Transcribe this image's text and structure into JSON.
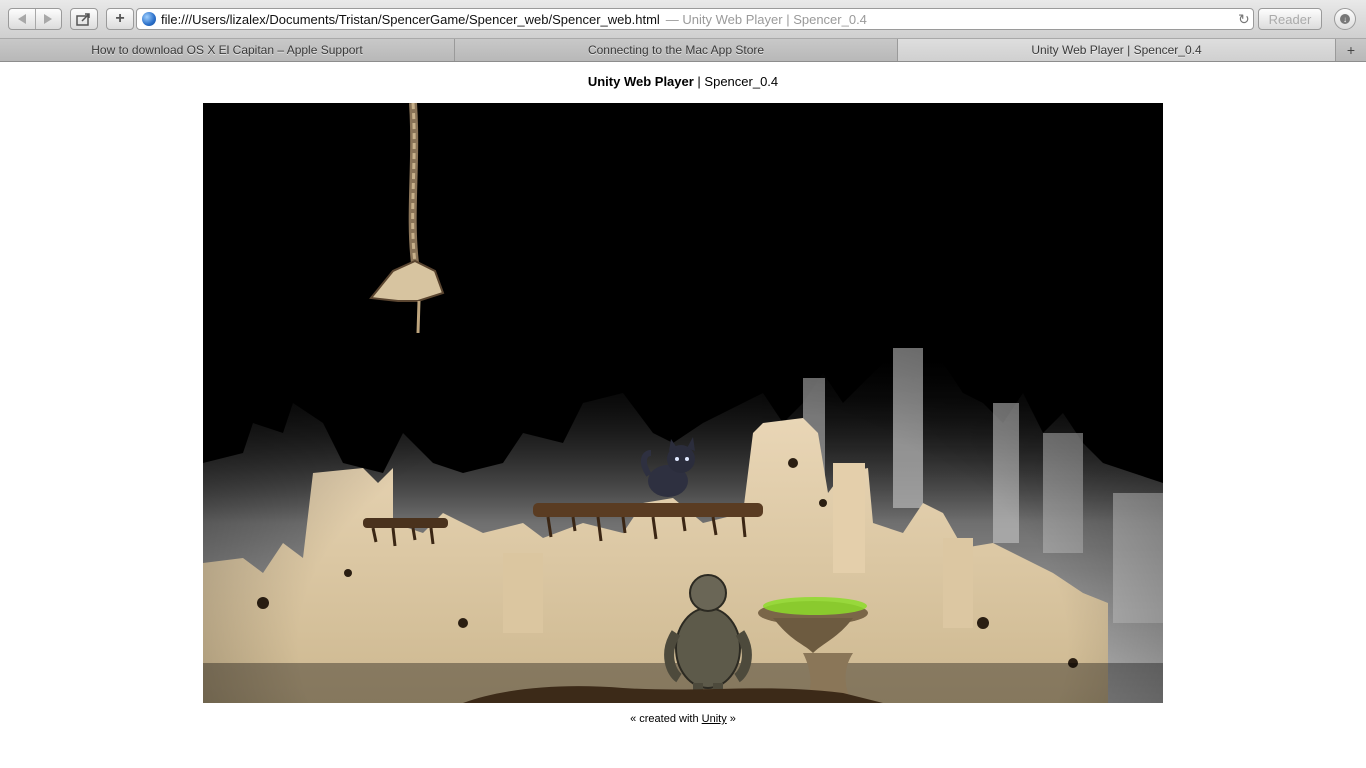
{
  "browser": {
    "url": "file:///Users/lizalex/Documents/Tristan/SpencerGame/Spencer_web/Spencer_web.html",
    "page_title_in_address": "— Unity Web Player | Spencer_0.4",
    "reader_label": "Reader",
    "new_tab_label": "+",
    "tabs": [
      {
        "label": "How to download OS X El Capitan – Apple Support",
        "active": false
      },
      {
        "label": "Connecting to the Mac App Store",
        "active": false
      },
      {
        "label": "Unity Web Player | Spencer_0.4",
        "active": true
      }
    ]
  },
  "page": {
    "heading_bold": "Unity Web Player",
    "heading_sep": " | ",
    "heading_rest": "Spencer_0.4",
    "footer_prefix": "« created with ",
    "footer_link": "Unity",
    "footer_suffix": " »"
  },
  "game": {
    "scene": "ruined-city-with-platforms",
    "colors": {
      "background": "#000000",
      "ruins": "#e8d5b5",
      "fog": "#9a9a9a",
      "moss": "#8ddc2a"
    }
  }
}
